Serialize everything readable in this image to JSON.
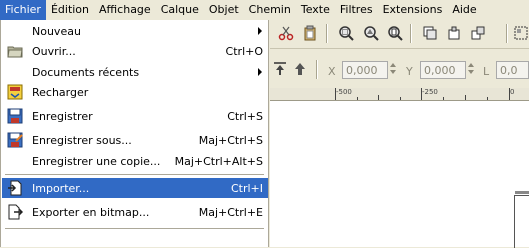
{
  "menubar": {
    "items": [
      "Fichier",
      "Édition",
      "Affichage",
      "Calque",
      "Objet",
      "Chemin",
      "Texte",
      "Filtres",
      "Extensions",
      "Aide"
    ]
  },
  "file_menu": {
    "items": [
      {
        "label": "Nouveau",
        "shortcut": "",
        "submenu": true,
        "icon": "none"
      },
      {
        "label": "Ouvrir...",
        "shortcut": "Ctrl+O",
        "submenu": false,
        "icon": "folder-icon"
      },
      {
        "label": "Documents récents",
        "shortcut": "",
        "submenu": true,
        "icon": "none"
      },
      {
        "label": "Recharger",
        "shortcut": "",
        "submenu": false,
        "icon": "reload-icon"
      },
      {
        "label": "Enregistrer",
        "shortcut": "Ctrl+S",
        "submenu": false,
        "icon": "save-icon"
      },
      {
        "label": "Enregistrer sous...",
        "shortcut": "Maj+Ctrl+S",
        "submenu": false,
        "icon": "save-as-icon"
      },
      {
        "label": "Enregistrer une copie...",
        "shortcut": "Maj+Ctrl+Alt+S",
        "submenu": false,
        "icon": "none"
      },
      {
        "label": "Importer...",
        "shortcut": "Ctrl+I",
        "submenu": false,
        "icon": "import-icon",
        "highlighted": true
      },
      {
        "label": "Exporter en bitmap...",
        "shortcut": "Maj+Ctrl+E",
        "submenu": false,
        "icon": "export-bitmap-icon"
      }
    ]
  },
  "toolbar2": {
    "x_label": "X",
    "x_value": "0,000",
    "y_label": "Y",
    "y_value": "0,000",
    "l_label": "L",
    "l_value": "0,0"
  },
  "ruler": {
    "labels": [
      "-500",
      "-250",
      "0"
    ]
  },
  "colors": {
    "accent": "#316ac5",
    "chrome": "#ece9d8"
  }
}
